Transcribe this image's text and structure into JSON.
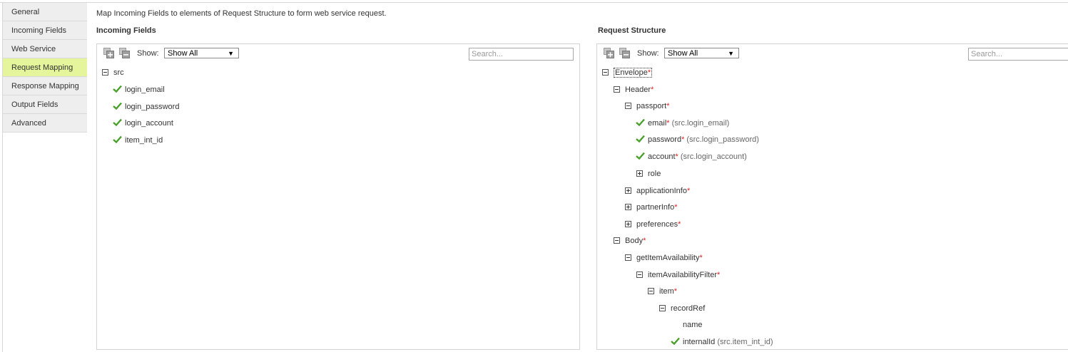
{
  "sidebar": {
    "items": [
      {
        "label": "General"
      },
      {
        "label": "Incoming Fields"
      },
      {
        "label": "Web Service"
      },
      {
        "label": "Request Mapping"
      },
      {
        "label": "Response Mapping"
      },
      {
        "label": "Output Fields"
      },
      {
        "label": "Advanced"
      }
    ],
    "active_index": 3
  },
  "intro_text": "Map Incoming Fields to elements of Request Structure to form web service request.",
  "incoming": {
    "title": "Incoming Fields",
    "show_label": "Show:",
    "show_value": "Show All",
    "search_placeholder": "Search...",
    "root": {
      "label": "src"
    },
    "fields": [
      {
        "label": "login_email"
      },
      {
        "label": "login_password"
      },
      {
        "label": "login_account"
      },
      {
        "label": "item_int_id"
      }
    ]
  },
  "request": {
    "title": "Request Structure",
    "show_label": "Show:",
    "show_value": "Show All",
    "search_placeholder": "Search...",
    "required_marker": "*",
    "nodes": {
      "envelope": {
        "label": "Envelope"
      },
      "header": {
        "label": "Header"
      },
      "passport": {
        "label": "passport"
      },
      "email": {
        "label": "email",
        "mapping": "(src.login_email)"
      },
      "password": {
        "label": "password",
        "mapping": "(src.login_password)"
      },
      "account": {
        "label": "account",
        "mapping": "(src.login_account)"
      },
      "role": {
        "label": "role"
      },
      "application_info": {
        "label": "applicationInfo"
      },
      "partner_info": {
        "label": "partnerInfo"
      },
      "preferences": {
        "label": "preferences"
      },
      "body": {
        "label": "Body"
      },
      "get_item_availability": {
        "label": "getItemAvailability"
      },
      "item_availability_filter": {
        "label": "itemAvailabilityFilter"
      },
      "item": {
        "label": "item"
      },
      "record_ref": {
        "label": "recordRef"
      },
      "name": {
        "label": "name"
      },
      "internal_id": {
        "label": "internalId",
        "mapping": "(src.item_int_id)"
      }
    }
  },
  "colors": {
    "active_tab": "#e4f59c",
    "check": "#4aa02c",
    "required": "#e02020"
  },
  "icons": {
    "expand_all": "expand-all-icon",
    "collapse_all": "collapse-all-icon",
    "checkmark": "checkmark-icon",
    "tree_expand": "plus-box-icon",
    "tree_collapse": "minus-box-icon"
  }
}
